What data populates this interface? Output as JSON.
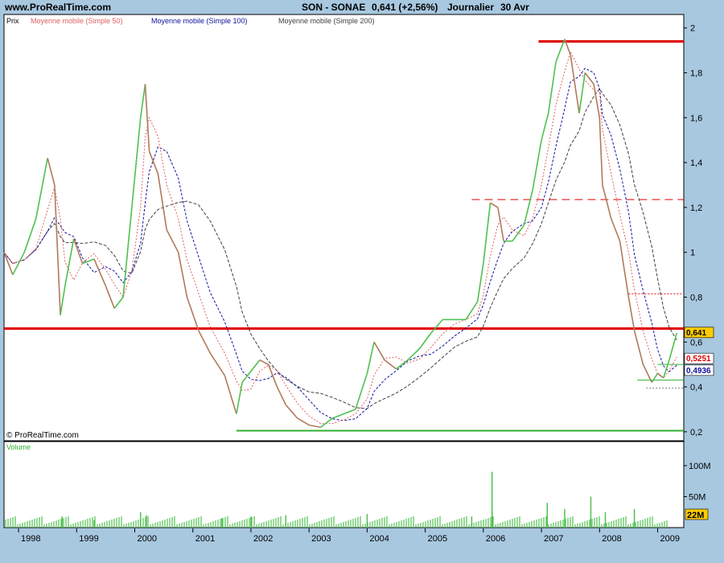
{
  "header": {
    "site": "www.ProRealTime.com",
    "ticker": "SON - SONAE",
    "quote": "0,641 (+2,56%)",
    "period": "Journalier",
    "date": "30 Avr"
  },
  "legend": {
    "price": "Prix",
    "ma50": "Moyenne mobile (Simple 50)",
    "ma100": "Moyenne mobile (Simple 100)",
    "ma200": "Moyenne mobile (Simple 200)"
  },
  "copyright": "© ProRealTime.com",
  "colors": {
    "background": "#a8c8e0",
    "panel": "#ffffff",
    "price_up": "#4fc04f",
    "price_down": "#b07a5a",
    "ma50": "#e06060",
    "ma100": "#1010a0",
    "ma200": "#404040",
    "red_line": "#e00000",
    "green_line": "#30b030",
    "last_price_badge": "#ffcc00"
  },
  "chart_data": {
    "type": "line",
    "xlim": [
      1997.75,
      2009.45
    ],
    "ylim": [
      0.16,
      2.06
    ],
    "x_ticks": [
      "1998",
      "1999",
      "2000",
      "2001",
      "2002",
      "2003",
      "2004",
      "2005",
      "2006",
      "2007",
      "2008",
      "2009"
    ],
    "y_ticks": [
      "0,2",
      "0,4",
      "0,6",
      "0,8",
      "1",
      "1,2",
      "1,4",
      "1,6",
      "1,8",
      "2"
    ],
    "price": [
      [
        1997.75,
        1.0
      ],
      [
        1997.9,
        0.9
      ],
      [
        1998.1,
        1.0
      ],
      [
        1998.3,
        1.15
      ],
      [
        1998.5,
        1.42
      ],
      [
        1998.62,
        1.3
      ],
      [
        1998.72,
        0.72
      ],
      [
        1998.8,
        0.85
      ],
      [
        1998.95,
        1.06
      ],
      [
        1999.1,
        0.95
      ],
      [
        1999.3,
        0.97
      ],
      [
        1999.5,
        0.85
      ],
      [
        1999.65,
        0.75
      ],
      [
        1999.8,
        0.8
      ],
      [
        1999.95,
        1.2
      ],
      [
        2000.1,
        1.6
      ],
      [
        2000.18,
        1.75
      ],
      [
        2000.25,
        1.45
      ],
      [
        2000.4,
        1.35
      ],
      [
        2000.55,
        1.1
      ],
      [
        2000.75,
        1.0
      ],
      [
        2000.9,
        0.8
      ],
      [
        2001.1,
        0.65
      ],
      [
        2001.3,
        0.55
      ],
      [
        2001.55,
        0.45
      ],
      [
        2001.75,
        0.28
      ],
      [
        2001.85,
        0.42
      ],
      [
        2002.0,
        0.47
      ],
      [
        2002.15,
        0.52
      ],
      [
        2002.3,
        0.5
      ],
      [
        2002.45,
        0.4
      ],
      [
        2002.6,
        0.32
      ],
      [
        2002.8,
        0.26
      ],
      [
        2003.0,
        0.23
      ],
      [
        2003.2,
        0.22
      ],
      [
        2003.4,
        0.26
      ],
      [
        2003.6,
        0.28
      ],
      [
        2003.8,
        0.3
      ],
      [
        2004.0,
        0.46
      ],
      [
        2004.12,
        0.6
      ],
      [
        2004.3,
        0.52
      ],
      [
        2004.5,
        0.48
      ],
      [
        2004.7,
        0.52
      ],
      [
        2004.9,
        0.57
      ],
      [
        2005.1,
        0.64
      ],
      [
        2005.3,
        0.7
      ],
      [
        2005.5,
        0.7
      ],
      [
        2005.7,
        0.7
      ],
      [
        2005.9,
        0.78
      ],
      [
        2006.0,
        0.95
      ],
      [
        2006.12,
        1.22
      ],
      [
        2006.25,
        1.2
      ],
      [
        2006.35,
        1.05
      ],
      [
        2006.5,
        1.05
      ],
      [
        2006.7,
        1.12
      ],
      [
        2006.85,
        1.28
      ],
      [
        2007.0,
        1.5
      ],
      [
        2007.12,
        1.62
      ],
      [
        2007.25,
        1.85
      ],
      [
        2007.4,
        1.95
      ],
      [
        2007.5,
        1.88
      ],
      [
        2007.65,
        1.62
      ],
      [
        2007.75,
        1.8
      ],
      [
        2007.9,
        1.75
      ],
      [
        2008.0,
        1.6
      ],
      [
        2008.05,
        1.3
      ],
      [
        2008.2,
        1.15
      ],
      [
        2008.35,
        1.05
      ],
      [
        2008.5,
        0.8
      ],
      [
        2008.6,
        0.65
      ],
      [
        2008.75,
        0.5
      ],
      [
        2008.9,
        0.42
      ],
      [
        2009.0,
        0.46
      ],
      [
        2009.1,
        0.44
      ],
      [
        2009.2,
        0.52
      ],
      [
        2009.33,
        0.641
      ]
    ],
    "horizontal_levels": [
      {
        "y": 0.66,
        "style": "solid-thick",
        "color": "red",
        "x_from": 1997.75,
        "x_to": 2009.45
      },
      {
        "y": 1.94,
        "style": "solid-thick",
        "color": "red",
        "x_from": 2006.95,
        "x_to": 2009.45
      },
      {
        "y": 1.235,
        "style": "dashed",
        "color": "red",
        "x_from": 2005.8,
        "x_to": 2009.45
      },
      {
        "y": 0.815,
        "style": "dotted",
        "color": "red",
        "x_from": 2008.5,
        "x_to": 2009.45
      },
      {
        "y": 0.205,
        "style": "solid",
        "color": "green",
        "x_from": 2001.75,
        "x_to": 2009.45
      },
      {
        "y": 0.43,
        "style": "solid-thin",
        "color": "green",
        "x_from": 2008.65,
        "x_to": 2009.45
      },
      {
        "y": 0.5,
        "style": "solid-thin",
        "color": "green",
        "x_from": 2009.0,
        "x_to": 2009.45
      },
      {
        "y": 0.395,
        "style": "dotted",
        "color": "gray",
        "x_from": 2008.8,
        "x_to": 2009.45
      }
    ],
    "last_values": [
      {
        "label": "0,641",
        "y": 0.641,
        "series": "price"
      },
      {
        "label": "0,5251",
        "y": 0.525,
        "series": "ma50"
      },
      {
        "label": "0,4936",
        "y": 0.494,
        "series": "ma100"
      }
    ],
    "volume": {
      "label": "Volume",
      "y_ticks": [
        "100M",
        "50M"
      ],
      "ylim": [
        0,
        135
      ],
      "last_label": "22M",
      "spikes": [
        [
          1998.75,
          18
        ],
        [
          1999.3,
          12
        ],
        [
          2000.1,
          25
        ],
        [
          2000.2,
          20
        ],
        [
          2001.5,
          15
        ],
        [
          2002.0,
          18
        ],
        [
          2002.6,
          20
        ],
        [
          2004.0,
          22
        ],
        [
          2005.8,
          18
        ],
        [
          2006.15,
          28
        ],
        [
          2006.15,
          90
        ],
        [
          2007.1,
          40
        ],
        [
          2007.4,
          30
        ],
        [
          2007.85,
          50
        ],
        [
          2008.1,
          25
        ],
        [
          2008.6,
          30
        ]
      ]
    }
  }
}
